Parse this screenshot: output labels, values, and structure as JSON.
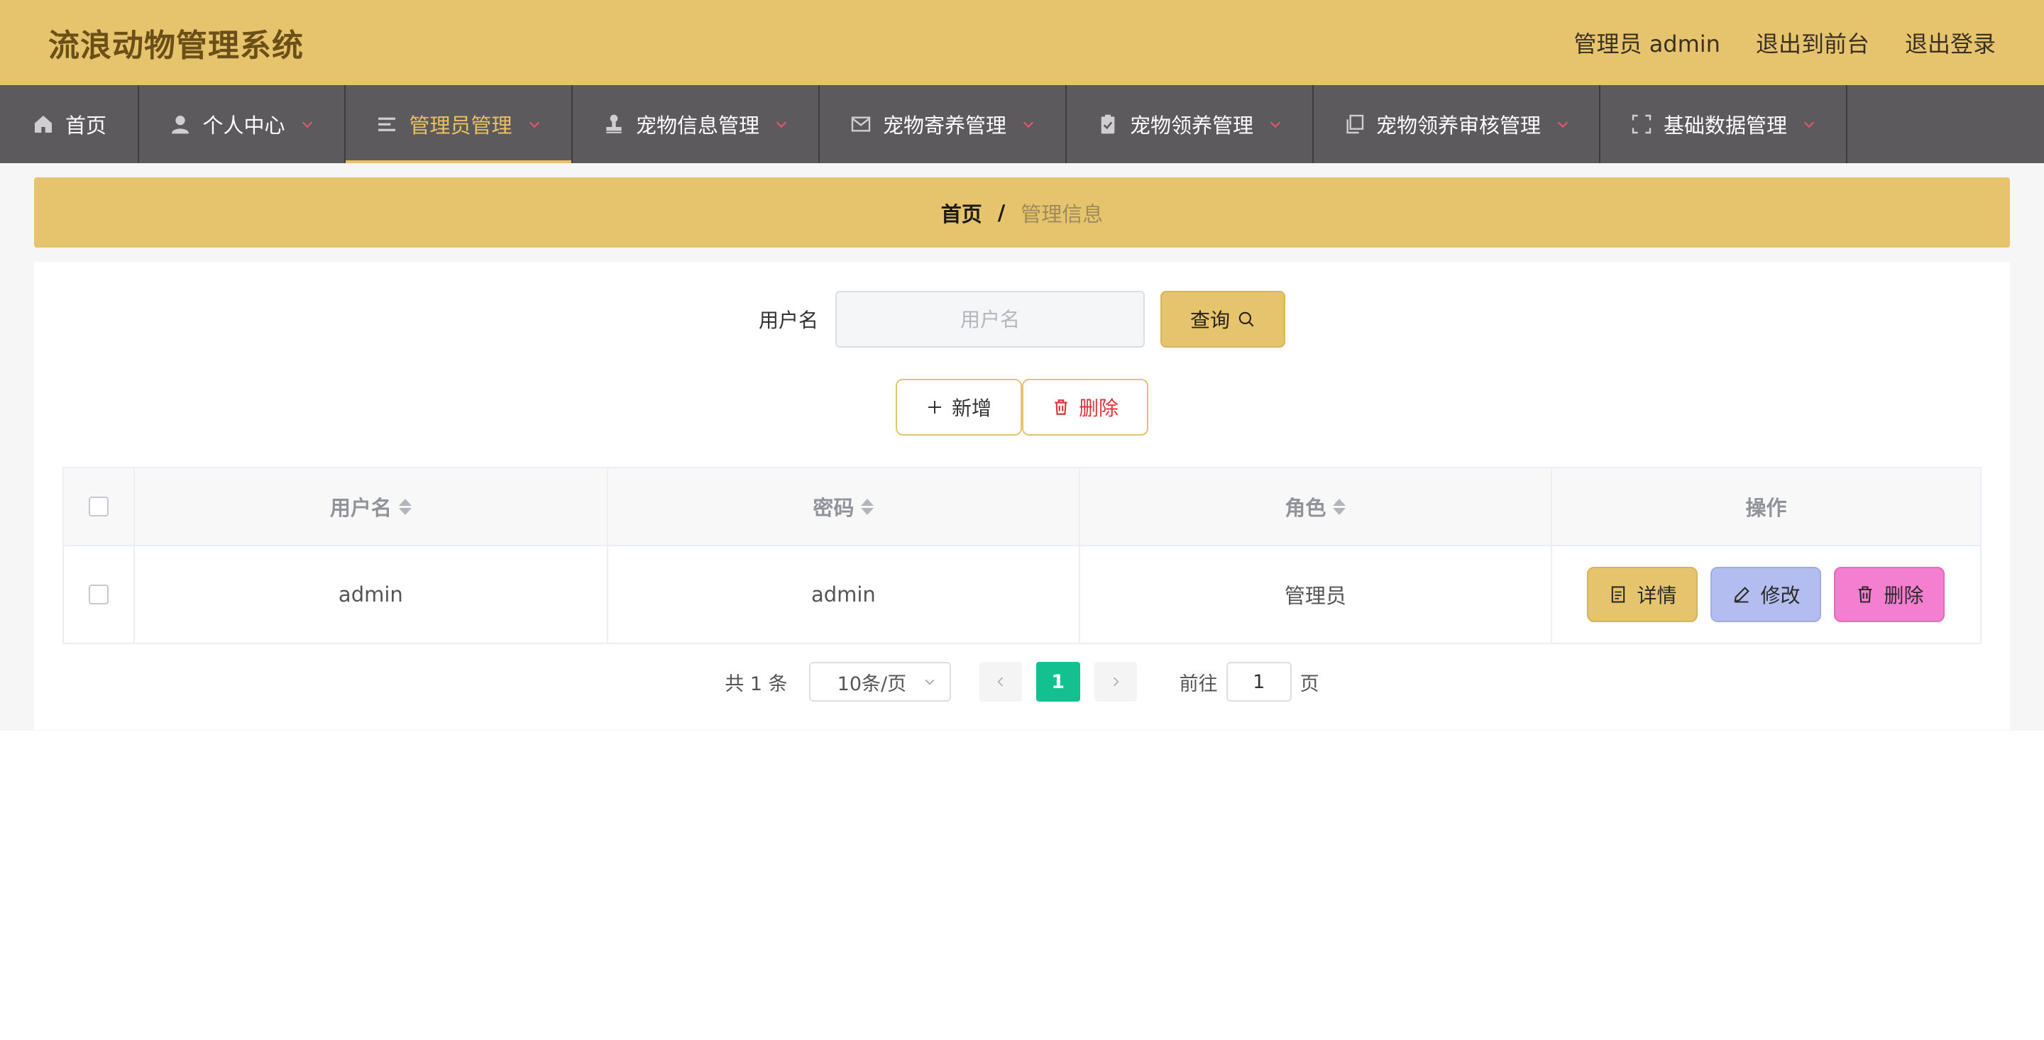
{
  "header": {
    "title": "流浪动物管理系统",
    "user_label": "管理员 admin",
    "to_front_label": "退出到前台",
    "logout_label": "退出登录"
  },
  "nav": {
    "items": [
      {
        "label": "首页",
        "icon": "home-icon"
      },
      {
        "label": "个人中心",
        "icon": "user-icon"
      },
      {
        "label": "管理员管理",
        "icon": "list-icon"
      },
      {
        "label": "宠物信息管理",
        "icon": "stamp-icon"
      },
      {
        "label": "宠物寄养管理",
        "icon": "mail-icon"
      },
      {
        "label": "宠物领养管理",
        "icon": "clipboard-check-icon"
      },
      {
        "label": "宠物领养审核管理",
        "icon": "copy-icon"
      },
      {
        "label": "基础数据管理",
        "icon": "fullscreen-icon"
      }
    ],
    "active_index": 2,
    "active_color": "#eac061"
  },
  "breadcrumb": {
    "home": "首页",
    "separator": "/",
    "current": "管理信息"
  },
  "search": {
    "label": "用户名",
    "placeholder": "用户名",
    "value": "",
    "button_label": "查询"
  },
  "actions": {
    "add_label": "新增",
    "delete_label": "删除"
  },
  "table": {
    "columns": [
      "用户名",
      "密码",
      "角色",
      "操作"
    ],
    "rows": [
      {
        "username": "admin",
        "password": "admin",
        "role": "管理员"
      }
    ],
    "row_actions": {
      "detail_label": "详情",
      "edit_label": "修改",
      "delete_label": "删除"
    }
  },
  "pagination": {
    "total_text": "共 1 条",
    "page_size": "10条/页",
    "current_page": "1",
    "goto_label": "前往",
    "goto_value": "1",
    "page_suffix": "页"
  },
  "colors": {
    "brand": "#e6c46e",
    "nav_bg": "#5c5a5c",
    "pager_active": "#13c08f",
    "edit_button": "#b4bdf0",
    "delete_button": "#f47fd0",
    "delete_text": "#e0343a"
  }
}
